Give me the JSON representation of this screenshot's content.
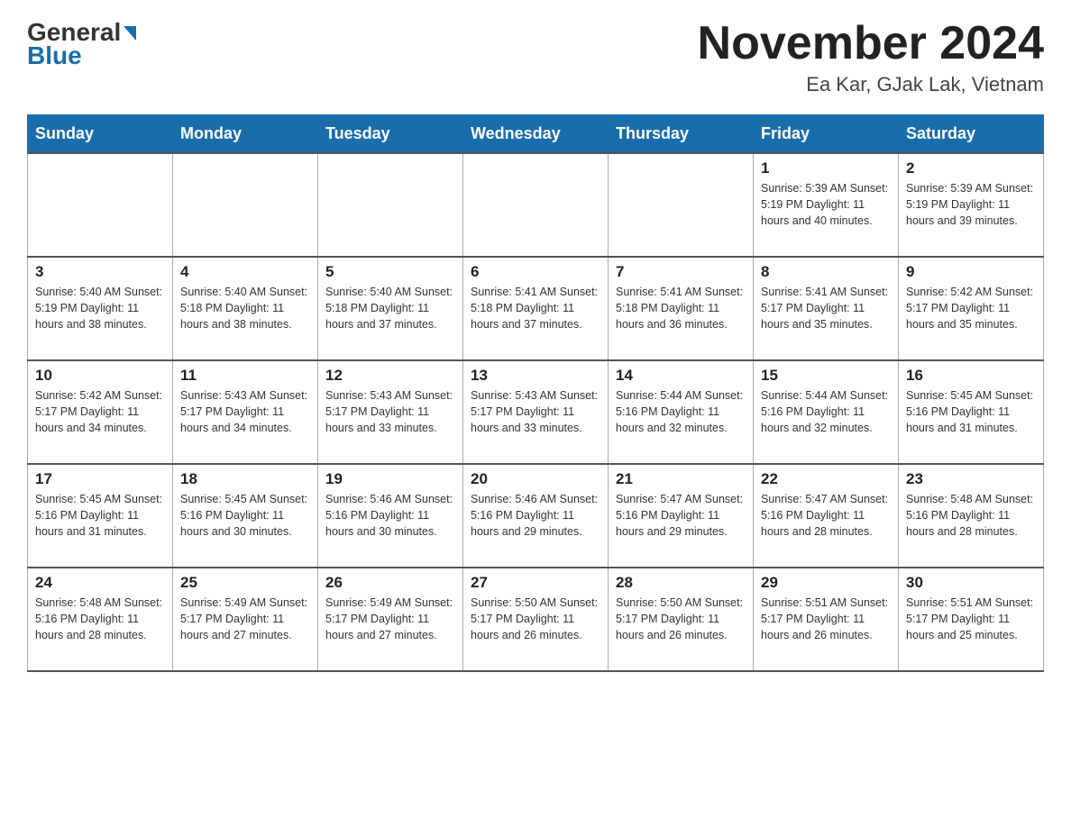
{
  "header": {
    "logo_general": "General",
    "logo_blue": "Blue",
    "month_title": "November 2024",
    "location": "Ea Kar, GJak Lak, Vietnam"
  },
  "days_of_week": [
    "Sunday",
    "Monday",
    "Tuesday",
    "Wednesday",
    "Thursday",
    "Friday",
    "Saturday"
  ],
  "weeks": [
    [
      {
        "day": "",
        "info": ""
      },
      {
        "day": "",
        "info": ""
      },
      {
        "day": "",
        "info": ""
      },
      {
        "day": "",
        "info": ""
      },
      {
        "day": "",
        "info": ""
      },
      {
        "day": "1",
        "info": "Sunrise: 5:39 AM\nSunset: 5:19 PM\nDaylight: 11 hours and 40 minutes."
      },
      {
        "day": "2",
        "info": "Sunrise: 5:39 AM\nSunset: 5:19 PM\nDaylight: 11 hours and 39 minutes."
      }
    ],
    [
      {
        "day": "3",
        "info": "Sunrise: 5:40 AM\nSunset: 5:19 PM\nDaylight: 11 hours and 38 minutes."
      },
      {
        "day": "4",
        "info": "Sunrise: 5:40 AM\nSunset: 5:18 PM\nDaylight: 11 hours and 38 minutes."
      },
      {
        "day": "5",
        "info": "Sunrise: 5:40 AM\nSunset: 5:18 PM\nDaylight: 11 hours and 37 minutes."
      },
      {
        "day": "6",
        "info": "Sunrise: 5:41 AM\nSunset: 5:18 PM\nDaylight: 11 hours and 37 minutes."
      },
      {
        "day": "7",
        "info": "Sunrise: 5:41 AM\nSunset: 5:18 PM\nDaylight: 11 hours and 36 minutes."
      },
      {
        "day": "8",
        "info": "Sunrise: 5:41 AM\nSunset: 5:17 PM\nDaylight: 11 hours and 35 minutes."
      },
      {
        "day": "9",
        "info": "Sunrise: 5:42 AM\nSunset: 5:17 PM\nDaylight: 11 hours and 35 minutes."
      }
    ],
    [
      {
        "day": "10",
        "info": "Sunrise: 5:42 AM\nSunset: 5:17 PM\nDaylight: 11 hours and 34 minutes."
      },
      {
        "day": "11",
        "info": "Sunrise: 5:43 AM\nSunset: 5:17 PM\nDaylight: 11 hours and 34 minutes."
      },
      {
        "day": "12",
        "info": "Sunrise: 5:43 AM\nSunset: 5:17 PM\nDaylight: 11 hours and 33 minutes."
      },
      {
        "day": "13",
        "info": "Sunrise: 5:43 AM\nSunset: 5:17 PM\nDaylight: 11 hours and 33 minutes."
      },
      {
        "day": "14",
        "info": "Sunrise: 5:44 AM\nSunset: 5:16 PM\nDaylight: 11 hours and 32 minutes."
      },
      {
        "day": "15",
        "info": "Sunrise: 5:44 AM\nSunset: 5:16 PM\nDaylight: 11 hours and 32 minutes."
      },
      {
        "day": "16",
        "info": "Sunrise: 5:45 AM\nSunset: 5:16 PM\nDaylight: 11 hours and 31 minutes."
      }
    ],
    [
      {
        "day": "17",
        "info": "Sunrise: 5:45 AM\nSunset: 5:16 PM\nDaylight: 11 hours and 31 minutes."
      },
      {
        "day": "18",
        "info": "Sunrise: 5:45 AM\nSunset: 5:16 PM\nDaylight: 11 hours and 30 minutes."
      },
      {
        "day": "19",
        "info": "Sunrise: 5:46 AM\nSunset: 5:16 PM\nDaylight: 11 hours and 30 minutes."
      },
      {
        "day": "20",
        "info": "Sunrise: 5:46 AM\nSunset: 5:16 PM\nDaylight: 11 hours and 29 minutes."
      },
      {
        "day": "21",
        "info": "Sunrise: 5:47 AM\nSunset: 5:16 PM\nDaylight: 11 hours and 29 minutes."
      },
      {
        "day": "22",
        "info": "Sunrise: 5:47 AM\nSunset: 5:16 PM\nDaylight: 11 hours and 28 minutes."
      },
      {
        "day": "23",
        "info": "Sunrise: 5:48 AM\nSunset: 5:16 PM\nDaylight: 11 hours and 28 minutes."
      }
    ],
    [
      {
        "day": "24",
        "info": "Sunrise: 5:48 AM\nSunset: 5:16 PM\nDaylight: 11 hours and 28 minutes."
      },
      {
        "day": "25",
        "info": "Sunrise: 5:49 AM\nSunset: 5:17 PM\nDaylight: 11 hours and 27 minutes."
      },
      {
        "day": "26",
        "info": "Sunrise: 5:49 AM\nSunset: 5:17 PM\nDaylight: 11 hours and 27 minutes."
      },
      {
        "day": "27",
        "info": "Sunrise: 5:50 AM\nSunset: 5:17 PM\nDaylight: 11 hours and 26 minutes."
      },
      {
        "day": "28",
        "info": "Sunrise: 5:50 AM\nSunset: 5:17 PM\nDaylight: 11 hours and 26 minutes."
      },
      {
        "day": "29",
        "info": "Sunrise: 5:51 AM\nSunset: 5:17 PM\nDaylight: 11 hours and 26 minutes."
      },
      {
        "day": "30",
        "info": "Sunrise: 5:51 AM\nSunset: 5:17 PM\nDaylight: 11 hours and 25 minutes."
      }
    ]
  ]
}
